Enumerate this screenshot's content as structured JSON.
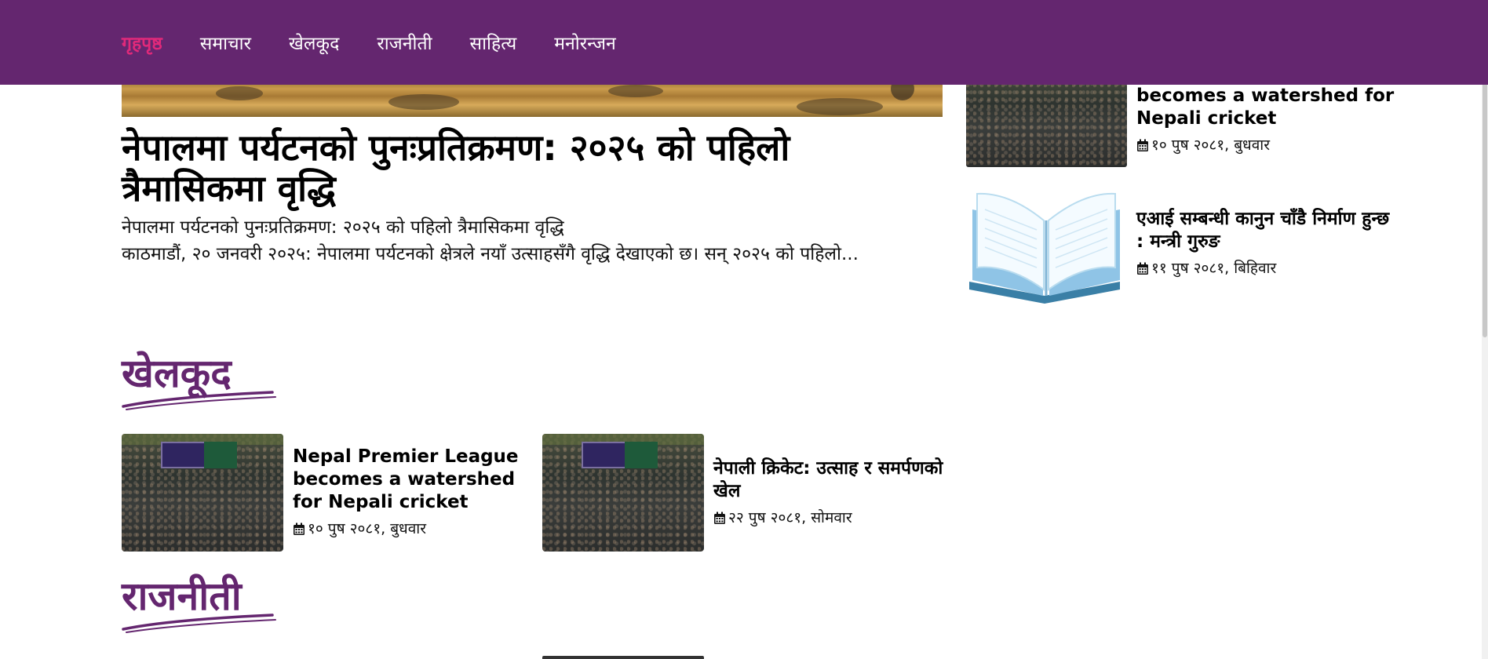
{
  "nav": {
    "items": [
      {
        "label": "गृहपृष्ठ",
        "active": true
      },
      {
        "label": "समाचार",
        "active": false
      },
      {
        "label": "खेलकूद",
        "active": false
      },
      {
        "label": "राजनीती",
        "active": false
      },
      {
        "label": "साहित्य",
        "active": false
      },
      {
        "label": "मनोरन्जन",
        "active": false
      }
    ],
    "background": "#64266f",
    "active_color": "#e0297a"
  },
  "hero": {
    "title": "नेपालमा पर्यटनको पुनःप्रतिक्रमण: २०२५ को पहिलो त्रैमासिकमा वृद्धि",
    "subtitle": "नेपालमा पर्यटनको पुनःप्रतिक्रमण: २०२५ को पहिलो त्रैमासिकमा वृद्धि",
    "excerpt": "काठमाडौं, २० जनवरी २०२५: नेपालमा पर्यटनको क्षेत्रले नयाँ उत्साहसँगै वृद्धि देखाएको छ। सन् २०२५ को पहिलो..."
  },
  "sidebar": {
    "items": [
      {
        "title": "becomes a watershed for Nepali cricket",
        "date": "१० पुष २०८१, बुधवार",
        "thumb": "stadium-crowd"
      },
      {
        "title": "एआई सम्बन्धी कानुन चाँडै निर्माण हुन्छ : मन्त्री गुरुङ",
        "date": "११ पुष २०८१, बिहिवार",
        "thumb": "open-book"
      }
    ]
  },
  "sections": {
    "sports": {
      "title": "खेलकूद",
      "cards": [
        {
          "title": "Nepal Premier League becomes a watershed for Nepali cricket",
          "date": "१० पुष २०८१, बुधवार"
        },
        {
          "title": "नेपाली क्रिकेट: उत्साह र समर्पणको खेल",
          "date": "२२ पुष २०८१, सोमवार"
        }
      ]
    },
    "politics": {
      "title": "राजनीती"
    }
  },
  "icons": {
    "date": "calendar-icon"
  },
  "colors": {
    "accent": "#64266f"
  }
}
